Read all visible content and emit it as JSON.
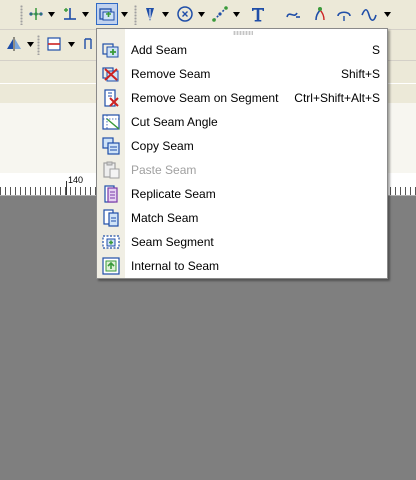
{
  "colors": {
    "toolbar_bg": "#ece9d8",
    "canvas_bg": "#7f7f7f",
    "menu_bg": "#ffffff",
    "disabled_text": "#a0a0a0",
    "accent_blue": "#1f4ea8",
    "icon_green": "#3a9a3a",
    "icon_red": "#cc2222"
  },
  "toolbar": {
    "row1": [
      "points-icon",
      "perpendicular-icon",
      "seam-tools-icon",
      "pen-tip-icon",
      "circle-point-icon",
      "dotted-line-icon",
      "text-tool-icon",
      "curve-icon",
      "seam-allowance-icon",
      "notch-icon",
      "wave-icon"
    ],
    "row2": [
      "mirror-icon",
      "fold-line-icon",
      "pleat-icon"
    ]
  },
  "ruler": {
    "label": "140"
  },
  "menu": {
    "items": [
      {
        "label": "Add Seam",
        "shortcut": "S",
        "icon": "add-seam-icon",
        "enabled": true
      },
      {
        "label": "Remove Seam",
        "shortcut": "Shift+S",
        "icon": "remove-seam-icon",
        "enabled": true
      },
      {
        "label": "Remove Seam on Segment",
        "shortcut": "Ctrl+Shift+Alt+S",
        "icon": "remove-seam-segment-icon",
        "enabled": true
      },
      {
        "label": "Cut Seam Angle",
        "shortcut": "",
        "icon": "cut-seam-angle-icon",
        "enabled": true
      },
      {
        "label": "Copy Seam",
        "shortcut": "",
        "icon": "copy-seam-icon",
        "enabled": true
      },
      {
        "label": "Paste Seam",
        "shortcut": "",
        "icon": "paste-seam-icon",
        "enabled": false
      },
      {
        "label": "Replicate Seam",
        "shortcut": "",
        "icon": "replicate-seam-icon",
        "enabled": true
      },
      {
        "label": "Match Seam",
        "shortcut": "",
        "icon": "match-seam-icon",
        "enabled": true
      },
      {
        "label": "Seam Segment",
        "shortcut": "",
        "icon": "seam-segment-icon",
        "enabled": true
      },
      {
        "label": "Internal to Seam",
        "shortcut": "",
        "icon": "internal-seam-icon",
        "enabled": true
      }
    ]
  }
}
